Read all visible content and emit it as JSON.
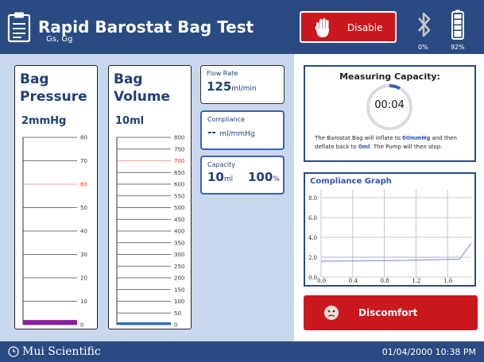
{
  "header": {
    "title": "Rapid Barostat Bag Test",
    "subtitle": "Gs, Gg",
    "disable_label": "Disable",
    "bluetooth_pct": "0%",
    "battery_pct": "92%"
  },
  "gauges": {
    "pressure": {
      "title1": "Bag",
      "title2": "Pressure",
      "value": "2mmHg",
      "ticks": [
        "80",
        "70",
        "60",
        "50",
        "40",
        "30",
        "20",
        "10",
        "0"
      ],
      "highlight": "60",
      "level": 2,
      "max": 80,
      "bar_color": "#8b1f9c"
    },
    "volume": {
      "title1": "Bag",
      "title2": "Volume",
      "value": "10ml",
      "ticks": [
        "800",
        "750",
        "700",
        "650",
        "600",
        "550",
        "500",
        "450",
        "400",
        "350",
        "300",
        "250",
        "200",
        "150",
        "100",
        "50",
        "0"
      ],
      "highlight": "700",
      "level": 10,
      "max": 800,
      "bar_color": "#2e6fbf"
    }
  },
  "cards": {
    "flow_label": "Flow Rate",
    "flow_value": "125",
    "flow_unit": "ml/min",
    "compliance_label": "Compliance",
    "compliance_value": "--",
    "compliance_unit": "ml/mmHg",
    "capacity_label": "Capacity",
    "capacity_value": "10",
    "capacity_unit": "ml",
    "capacity_pct": "100",
    "capacity_pct_unit": "%"
  },
  "measuring": {
    "title": "Measuring Capacity:",
    "timer": "00:04",
    "desc_1": "The Barostat Bag will inflate to ",
    "desc_hl1": "60mmHg",
    "desc_2": " and then deflate back to ",
    "desc_hl2": "0ml",
    "desc_3": ". The Pump will then stop."
  },
  "graph": {
    "title": "Compliance Graph",
    "y_ticks": [
      "8.0",
      "6.0",
      "4.0",
      "2.0",
      "0.0"
    ],
    "x_ticks": [
      "0.0",
      "0.4",
      "0.8",
      "1.2",
      "1.6"
    ],
    "x_range": [
      0,
      1.9
    ],
    "y_range": [
      0,
      8.8
    ],
    "series": [
      {
        "points": [
          [
            0,
            1.6
          ],
          [
            0.85,
            1.65
          ],
          [
            1.75,
            1.8
          ],
          [
            1.9,
            3.4
          ]
        ]
      },
      {
        "points": [
          [
            0,
            2.0
          ],
          [
            1.75,
            2.0
          ]
        ]
      }
    ]
  },
  "discomfort_label": "Discomfort",
  "footer": {
    "brand": "Mui Scientific",
    "datetime": "01/04/2000 10:38 PM"
  },
  "colors": {
    "header_bg": "#2a4a82",
    "accent": "#2b55b3",
    "alarm": "#c9191e",
    "threshold": "#e0302a"
  }
}
